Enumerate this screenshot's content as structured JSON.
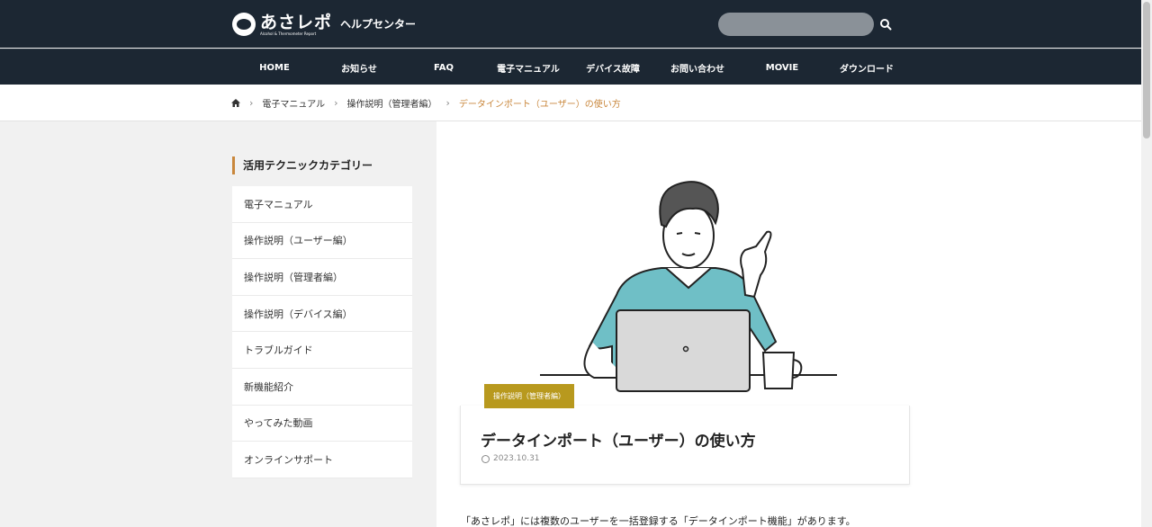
{
  "header": {
    "logo_main": "あさレポ",
    "logo_sub": "Alcohol & Thermometer Report",
    "help_title": "ヘルプセンター",
    "search_placeholder": ""
  },
  "nav": [
    {
      "label": "HOME"
    },
    {
      "label": "お知らせ"
    },
    {
      "label": "FAQ"
    },
    {
      "label": "電子マニュアル"
    },
    {
      "label": "デバイス故障"
    },
    {
      "label": "お問い合わせ"
    },
    {
      "label": "MOVIE"
    },
    {
      "label": "ダウンロード"
    }
  ],
  "breadcrumb": {
    "home_icon": "home-icon",
    "items": [
      "電子マニュアル",
      "操作説明（管理者編）"
    ],
    "current": "データインポート（ユーザー）の使い方"
  },
  "sidebar": {
    "title": "活用テクニックカテゴリー",
    "items": [
      {
        "label": "電子マニュアル"
      },
      {
        "label": "操作説明（ユーザー編）"
      },
      {
        "label": "操作説明（管理者編）"
      },
      {
        "label": "操作説明（デバイス編）"
      },
      {
        "label": "トラブルガイド"
      },
      {
        "label": "新機能紹介"
      },
      {
        "label": "やってみた動画"
      },
      {
        "label": "オンラインサポート"
      }
    ]
  },
  "post": {
    "category": "操作説明（管理者編）",
    "title": "データインポート（ユーザー）の使い方",
    "date": "2023.10.31",
    "intro": "「あさレポ」には複数のユーザーを一括登録する「データインポート機能」があります。"
  },
  "colors": {
    "header_bg": "#1c2733",
    "accent": "#c9873c",
    "badge": "#b8991e",
    "shirt": "#6fbfc6"
  }
}
